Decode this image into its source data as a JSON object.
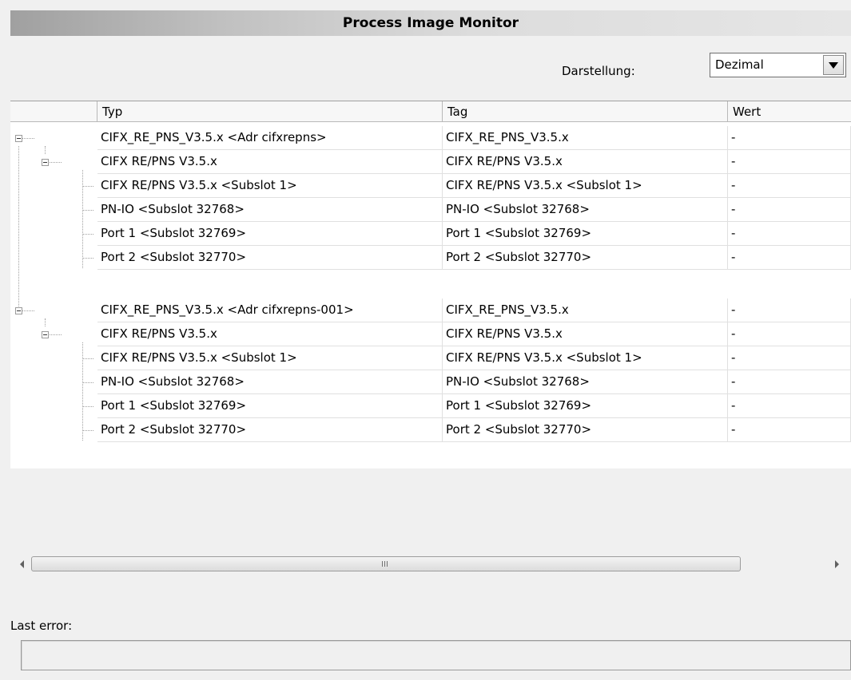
{
  "window": {
    "title": "Process Image Monitor"
  },
  "display": {
    "label": "Darstellung:",
    "selected": "Dezimal"
  },
  "table": {
    "headers": {
      "typ": "Typ",
      "tag": "Tag",
      "wert": "Wert"
    },
    "rows": [
      {
        "typ": "CIFX_RE_PNS_V3.5.x <Adr cifxrepns>",
        "tag": "CIFX_RE_PNS_V3.5.x",
        "wert": "-"
      },
      {
        "typ": "CIFX RE/PNS V3.5.x",
        "tag": "CIFX RE/PNS V3.5.x",
        "wert": "-"
      },
      {
        "typ": "CIFX RE/PNS V3.5.x <Subslot 1>",
        "tag": "CIFX RE/PNS V3.5.x <Subslot 1>",
        "wert": "-"
      },
      {
        "typ": "PN-IO <Subslot 32768>",
        "tag": "PN-IO <Subslot 32768>",
        "wert": "-"
      },
      {
        "typ": "Port 1 <Subslot 32769>",
        "tag": "Port 1 <Subslot 32769>",
        "wert": "-"
      },
      {
        "typ": "Port 2 <Subslot 32770>",
        "tag": "Port 2 <Subslot 32770>",
        "wert": "-"
      },
      {
        "typ": "CIFX_RE_PNS_V3.5.x <Adr cifxrepns-001>",
        "tag": "CIFX_RE_PNS_V3.5.x",
        "wert": "-"
      },
      {
        "typ": "CIFX RE/PNS V3.5.x",
        "tag": "CIFX RE/PNS V3.5.x",
        "wert": "-"
      },
      {
        "typ": "CIFX RE/PNS V3.5.x <Subslot 1>",
        "tag": "CIFX RE/PNS V3.5.x <Subslot 1>",
        "wert": "-"
      },
      {
        "typ": "PN-IO <Subslot 32768>",
        "tag": "PN-IO <Subslot 32768>",
        "wert": "-"
      },
      {
        "typ": "Port 1 <Subslot 32769>",
        "tag": "Port 1 <Subslot 32769>",
        "wert": "-"
      },
      {
        "typ": "Port 2 <Subslot 32770>",
        "tag": "Port 2 <Subslot 32770>",
        "wert": "-"
      }
    ]
  },
  "scrollbar": {
    "grip_icon": "scroll-grip-icon"
  },
  "status": {
    "last_error_label": "Last error:",
    "last_error_value": ""
  }
}
